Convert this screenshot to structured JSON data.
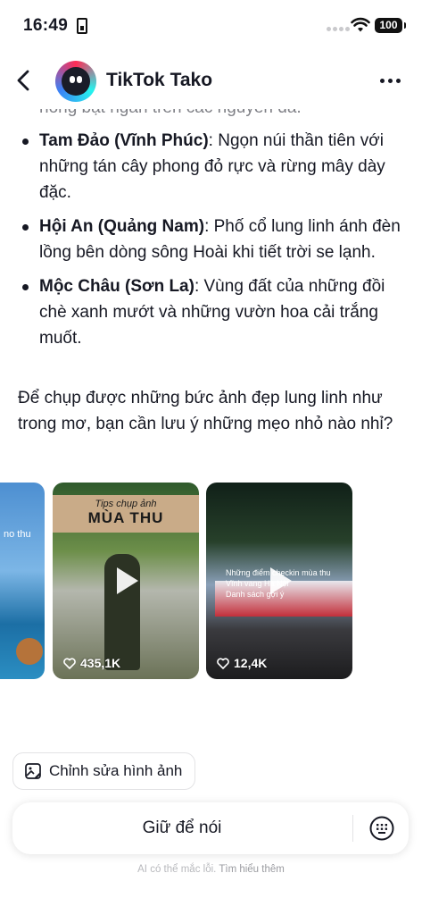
{
  "status_bar": {
    "time": "16:49",
    "battery": "100",
    "icons": [
      "sim-card-icon",
      "wifi-icon",
      "battery-icon"
    ]
  },
  "header": {
    "title": "TikTok Tako",
    "back_icon": "chevron-left-icon",
    "more_icon": "more-horizontal-icon"
  },
  "content": {
    "faded_line": "nong bật ngàn trên các nguyên đà.",
    "bullets": [
      {
        "name": "Tam Đảo (Vĩnh Phúc)",
        "text": ": Ngọn núi thần tiên với những tán cây phong đỏ rực và rừng mây dày đặc."
      },
      {
        "name": "Hội An (Quảng Nam)",
        "text": ": Phố cổ lung linh ánh đèn lồng bên dòng sông Hoài khi tiết trời se lạnh."
      },
      {
        "name": "Mộc Châu (Sơn La)",
        "text": ": Vùng đất của những đồi chè xanh mướt và những vườn hoa cải trắng muốt."
      }
    ],
    "paragraph": "Để chụp được những bức ảnh đẹp lung linh như trong mơ, bạn cần lưu ý những mẹo nhỏ nào nhỉ?"
  },
  "videos": [
    {
      "caption": "no thu",
      "likes": ""
    },
    {
      "tips": "Tips chụp ảnh",
      "title": "MÙA THU",
      "likes": "435,1K"
    },
    {
      "caption_line1": "Những điểm checkin mùa thu",
      "caption_line2": "Vĩnh vang Hà Nội",
      "caption_line3": "Danh sách gợi ý",
      "likes": "12,4K"
    }
  ],
  "actions": [
    "thumbs-up-icon",
    "thumbs-down-icon",
    "share-icon",
    "copy-icon"
  ],
  "edit_chip": {
    "label": "Chỉnh sửa hình ảnh",
    "icon": "image-edit-icon"
  },
  "input": {
    "label": "Giữ để nói",
    "icon": "keyboard-icon"
  },
  "disclaimer": {
    "text": "AI có thể mắc lỗi. ",
    "link": "Tìm hiểu thêm"
  },
  "colors": {
    "text": "#161823",
    "muted": "#b8b9bd",
    "border": "#e3e3e5"
  }
}
